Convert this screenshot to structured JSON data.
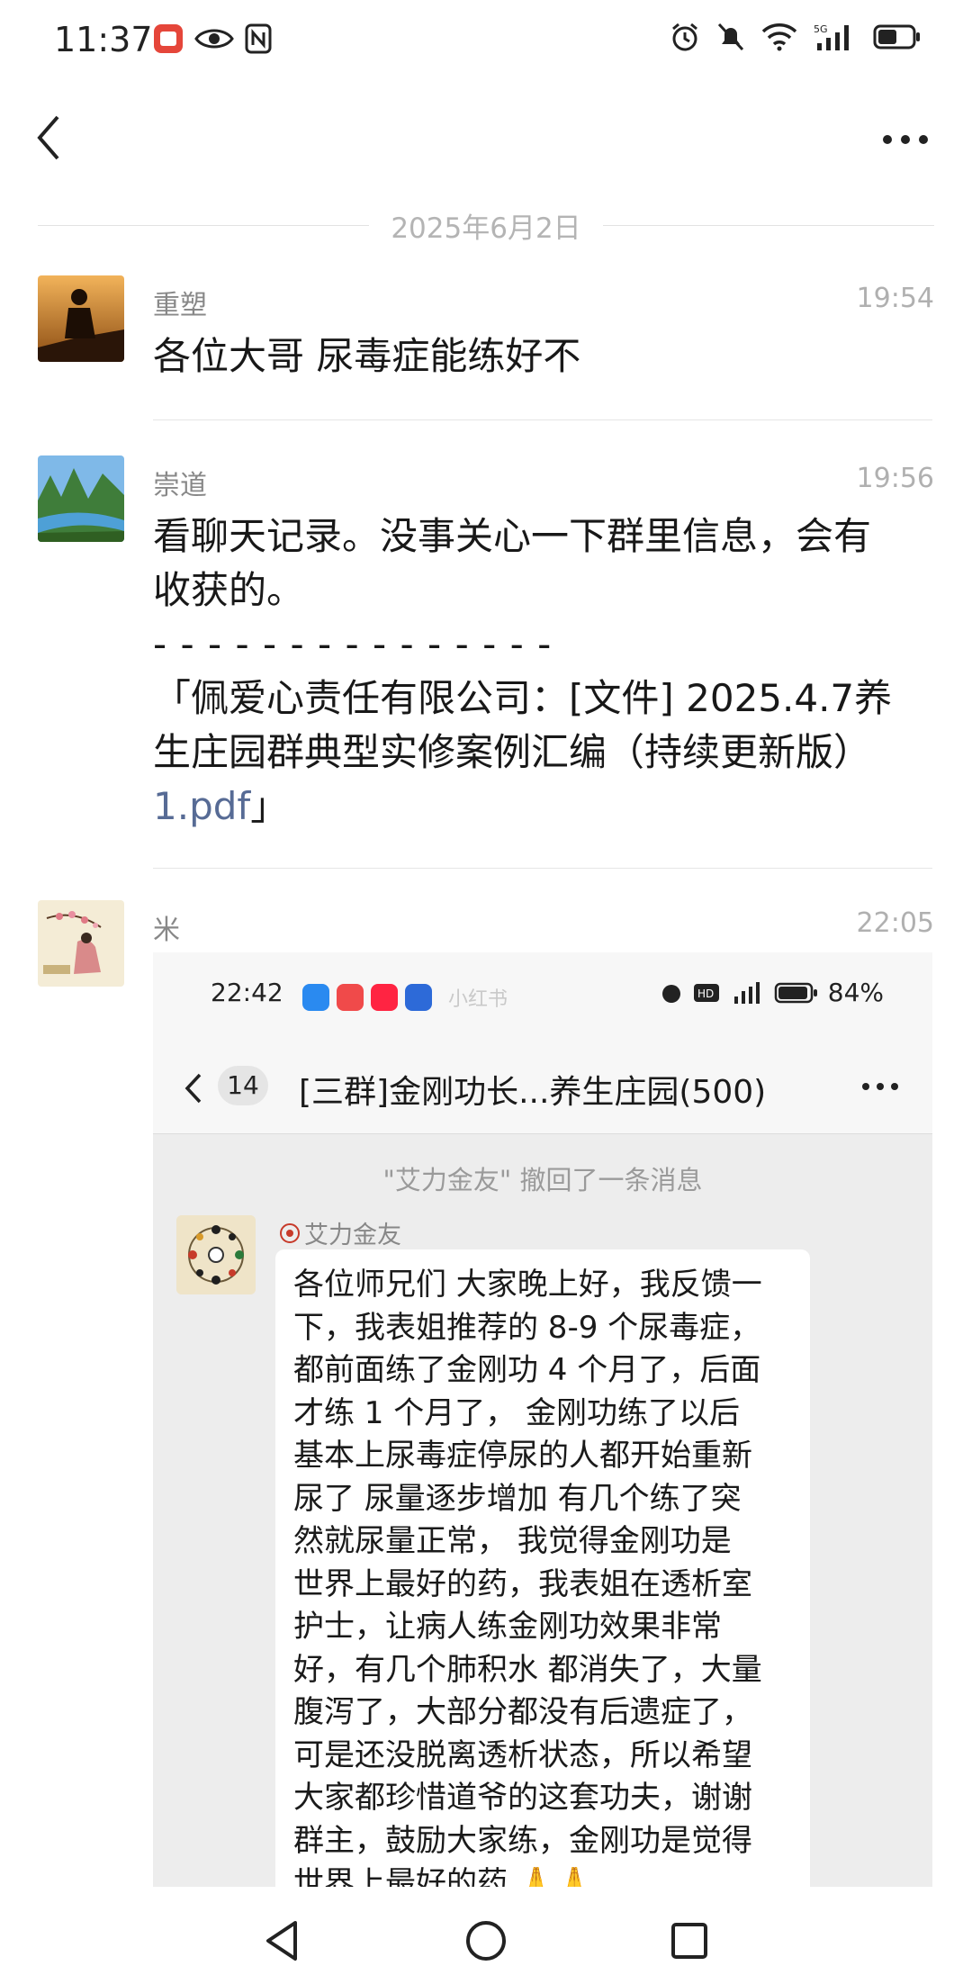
{
  "status_bar": {
    "time": "11:37",
    "left_icons": [
      "app-badge-icon",
      "eye-icon",
      "nfc-icon"
    ],
    "right_icons": [
      "alarm-icon",
      "mute-icon",
      "wifi-icon",
      "signal-5g-icon",
      "battery-icon"
    ]
  },
  "navbar": {
    "back_icon": "chevron-left-icon",
    "more_icon": "more-dots-icon"
  },
  "date_separator": "2025年6月2日",
  "messages": [
    {
      "sender": "重塑",
      "time": "19:54",
      "text": "各位大哥 尿毒症能练好不"
    },
    {
      "sender": "崇道",
      "time": "19:56",
      "line1": "看聊天记录。没事关心一下群里信息，会有",
      "line2": "收获的。",
      "line3": "- - - - - - - - - - - - - - -",
      "line4": "「佩爱心责任有限公司：[文件] 2025.4.7养",
      "line5": "生庄园群典型实修案例汇编（持续更新版）",
      "link_text": "1.pdf",
      "link_suffix": "」"
    },
    {
      "sender": "米",
      "time": "22:05"
    }
  ],
  "screenshot": {
    "status_time": "22:42",
    "watermark": "小红书",
    "battery": "84%",
    "badge": "14",
    "title": "[三群]金刚功长...养生庄园(500)",
    "recall_notice": "\"艾力金友\" 撤回了一条消息",
    "sender": "艾力金友",
    "lines": [
      "各位师兄们 大家晚上好，我反馈一",
      "下，我表姐推荐的 8-9 个尿毒症，",
      "都前面练了金刚功 4 个月了，后面",
      "才练 1 个月了，  金刚功练了以后",
      "基本上尿毒症停尿的人都开始重新",
      "尿了 尿量逐步增加 有几个练了突",
      "然就尿量正常，  我觉得金刚功是",
      "世界上最好的药，我表姐在透析室",
      "护士，让病人练金刚功效果非常",
      "好，有几个肺积水 都消失了，大量",
      "腹泻了，大部分都没有后遗症了，",
      "可是还没脱离透析状态，所以希望",
      "大家都珍惜道爷的这套功夫，谢谢",
      "群主，鼓励大家练，金刚功是觉得",
      "世界上最好的药  🙏🙏"
    ]
  },
  "system_nav": {
    "back": "triangle-back-icon",
    "home": "circle-home-icon",
    "recents": "square-recents-icon"
  }
}
